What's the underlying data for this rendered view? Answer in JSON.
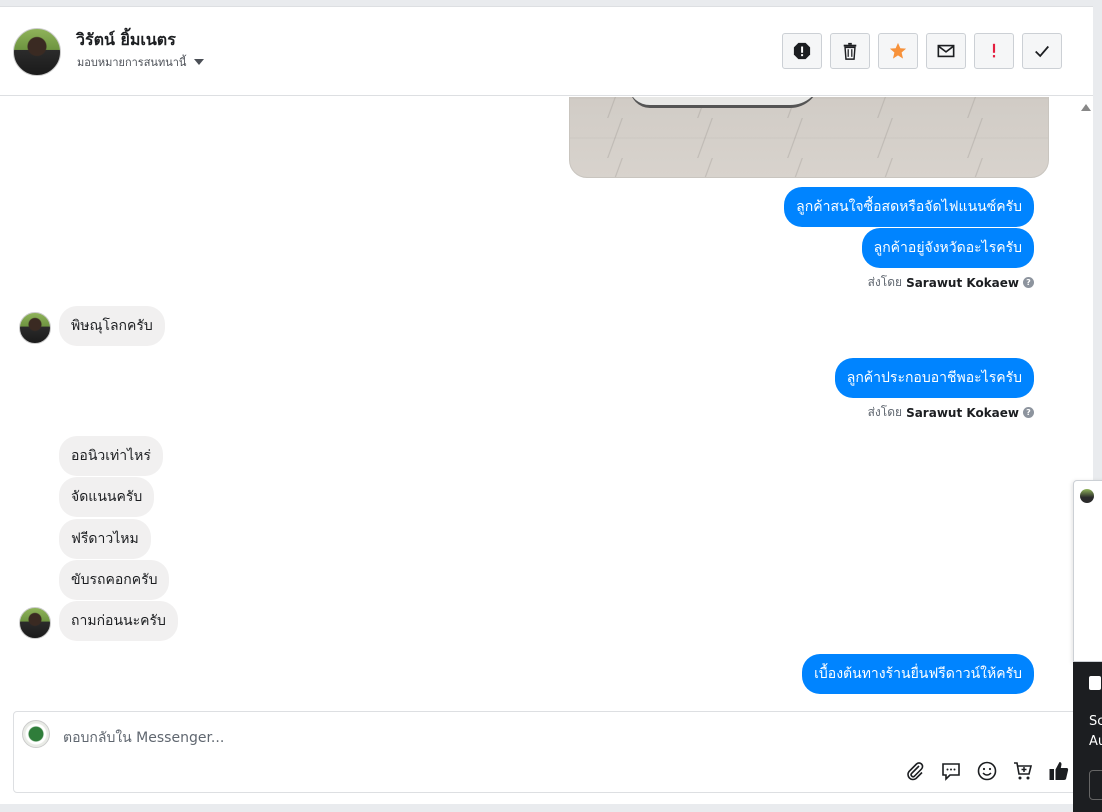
{
  "header": {
    "contact_name": "วิรัตน์ ยิ้มเนตร",
    "assign_label": "มอบหมายการสนทนานี้",
    "actions": [
      {
        "name": "spam-button",
        "icon": "alert-octagon-icon"
      },
      {
        "name": "delete-button",
        "icon": "trash-icon"
      },
      {
        "name": "star-button",
        "icon": "star-icon"
      },
      {
        "name": "mark-unread-button",
        "icon": "envelope-icon"
      },
      {
        "name": "follow-up-button",
        "icon": "exclamation-icon"
      },
      {
        "name": "mark-done-button",
        "icon": "check-icon"
      }
    ],
    "star_color": "#f7923b",
    "follow_up_color": "#e41e3f"
  },
  "messages": {
    "out1": "ลูกค้าสนใจซื้อสดหรือจัดไฟแนนซ์ครับ",
    "out2": "ลูกค้าอยู่จังหวัดอะไรครับ",
    "sent_by_prefix": "ส่งโดย",
    "sent_by_name": "Sarawut Kokaew",
    "in1": "พิษณุโลกครับ",
    "out3": "ลูกค้าประกอบอาชีพอะไรครับ",
    "sent_by_prefix_2": "ส่งโดย",
    "sent_by_name_2": "Sarawut Kokaew",
    "in2": "ออนิวเท่าไหร่",
    "in3": "จัดแนนครับ",
    "in4": "ฟรีดาวไหม",
    "in5": "ขับรถคอกครับ",
    "in6": "ถามก่อนนะครับ",
    "out4": "เบื้องต้นทางร้านยื่นฟรีดาวน์ให้ครับ"
  },
  "composer": {
    "placeholder": "ตอบกลับใน Messenger...",
    "tools": [
      "paperclip-icon",
      "saved-reply-icon",
      "emoji-icon",
      "cart-icon",
      "like-icon"
    ]
  },
  "widget": {
    "line1": "Sc",
    "line2": "Au"
  },
  "colors": {
    "outgoing_bubble": "#0084ff",
    "incoming_bubble": "#f1f0f0"
  }
}
